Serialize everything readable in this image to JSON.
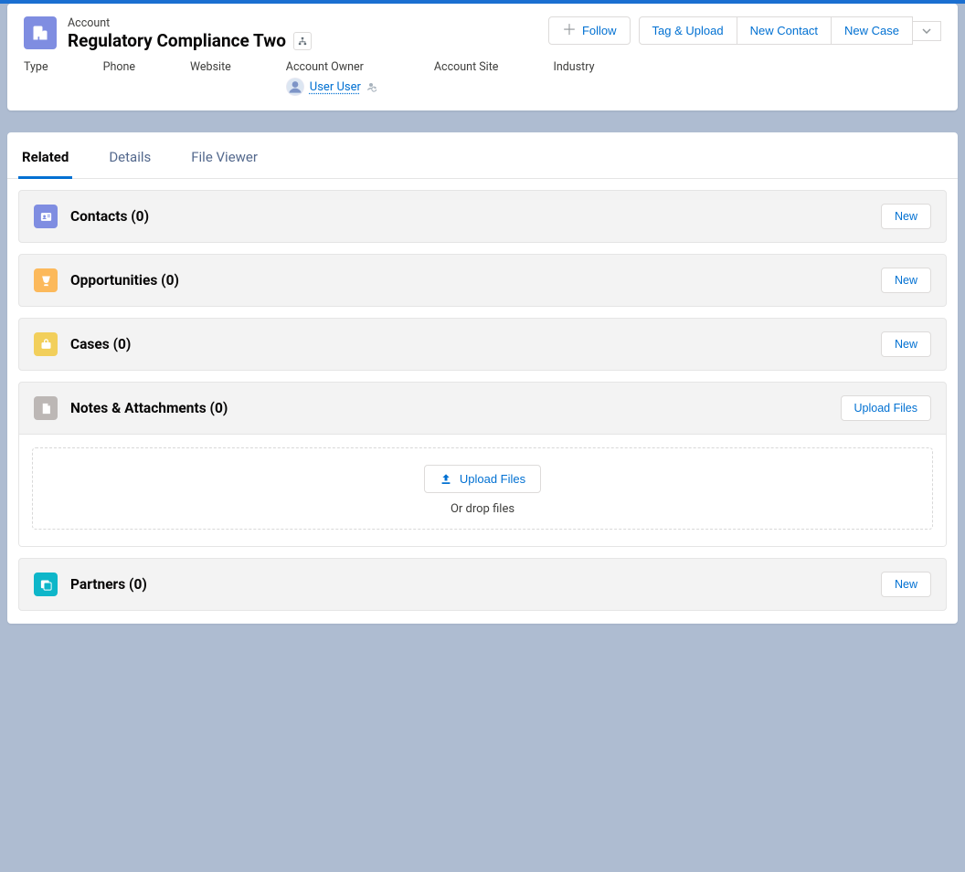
{
  "header": {
    "object_label": "Account",
    "record_name": "Regulatory Compliance Two",
    "actions": {
      "follow": "Follow",
      "tag_upload": "Tag & Upload",
      "new_contact": "New Contact",
      "new_case": "New Case"
    }
  },
  "fields": {
    "type": {
      "label": "Type"
    },
    "phone": {
      "label": "Phone"
    },
    "website": {
      "label": "Website"
    },
    "owner": {
      "label": "Account Owner",
      "value": "User User"
    },
    "site": {
      "label": "Account Site"
    },
    "industry": {
      "label": "Industry"
    }
  },
  "tabs": {
    "related": "Related",
    "details": "Details",
    "file_viewer": "File Viewer"
  },
  "related": {
    "contacts": {
      "title": "Contacts (0)",
      "action": "New"
    },
    "opportunities": {
      "title": "Opportunities (0)",
      "action": "New"
    },
    "cases": {
      "title": "Cases (0)",
      "action": "New"
    },
    "notes": {
      "title": "Notes & Attachments (0)",
      "action": "Upload Files",
      "drop_action": "Upload Files",
      "drop_hint": "Or drop files"
    },
    "partners": {
      "title": "Partners (0)",
      "action": "New"
    }
  }
}
